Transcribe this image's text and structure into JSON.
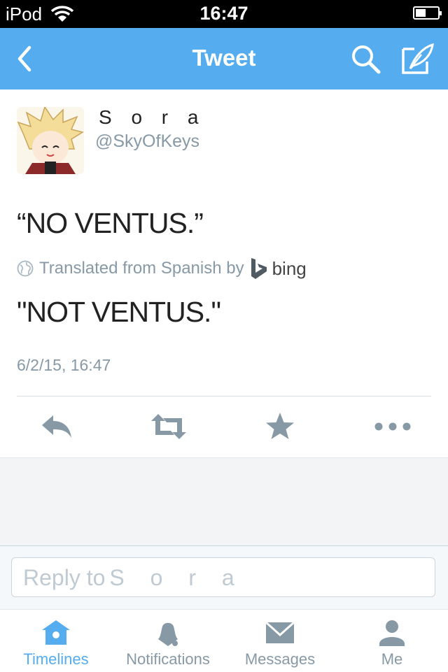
{
  "status_bar": {
    "carrier": "iPod",
    "time": "16:47"
  },
  "nav": {
    "title": "Tweet"
  },
  "tweet": {
    "name": "S o r a",
    "handle": "@SkyOfKeys",
    "text": "“NO VENTUS.”",
    "translation_note": "Translated from Spanish by",
    "translator": "bing",
    "translated_text": "\"NOT VENTUS.\"",
    "timestamp": "6/2/15, 16:47"
  },
  "reply": {
    "placeholder_prefix": "Reply to",
    "placeholder_name": "S o r a"
  },
  "tabs": [
    {
      "label": "Timelines",
      "icon": "home-icon",
      "active": true
    },
    {
      "label": "Notifications",
      "icon": "bell-icon",
      "active": false
    },
    {
      "label": "Messages",
      "icon": "envelope-icon",
      "active": false
    },
    {
      "label": "Me",
      "icon": "person-icon",
      "active": false
    }
  ],
  "colors": {
    "accent": "#55acee",
    "secondary_text": "#8899a6",
    "action_icons": "#8899a6"
  }
}
